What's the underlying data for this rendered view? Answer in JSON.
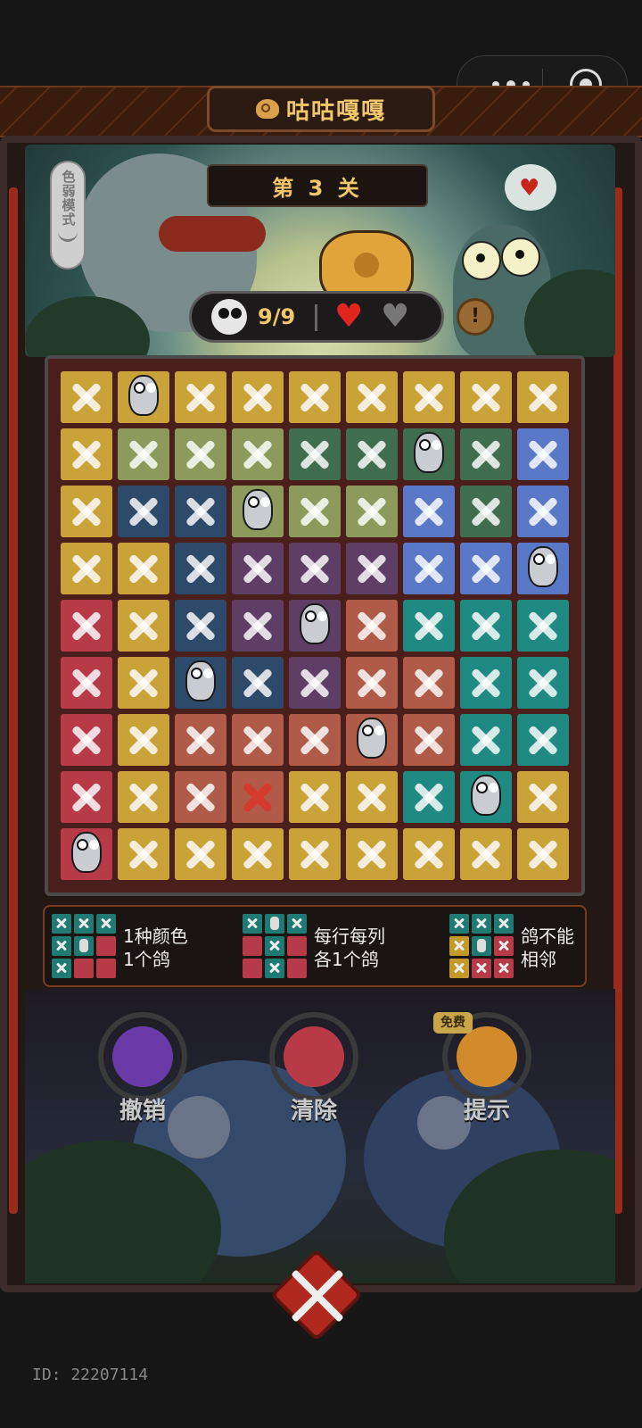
{
  "game": {
    "title": "咕咕嘎嘎",
    "level_label": "第 3 关",
    "colorblind_mode_label": "色弱模式",
    "pigeons_found": "9/9",
    "hearts_remaining": 1,
    "hearts_total": 2,
    "info_icon": "exclamation-icon"
  },
  "board": {
    "rows": 9,
    "cols": 9,
    "colors": {
      "Y": "#c9a23a",
      "O": "#8c9a5c",
      "G": "#3e6e4e",
      "N": "#2e4a6a",
      "B": "#5a78c8",
      "P": "#5e3e64",
      "R": "#b63a48",
      "S": "#b05a48",
      "T": "#1f8a82"
    },
    "regions": [
      "YYYYYYYYY",
      "YOOOGGGGB",
      "YNNOOOBGB",
      "YYNPPPBBB",
      "RYNPPSTTT",
      "RYNNPSSTT",
      "RYSSSSSTT",
      "RYSSYYTTY",
      "RYYYYYYYY"
    ],
    "pigeons": [
      [
        0,
        1
      ],
      [
        1,
        6
      ],
      [
        2,
        3
      ],
      [
        3,
        8
      ],
      [
        4,
        4
      ],
      [
        5,
        2
      ],
      [
        6,
        5
      ],
      [
        7,
        7
      ],
      [
        8,
        0
      ]
    ],
    "red_marks": [
      [
        7,
        3
      ]
    ]
  },
  "rules": [
    {
      "text": "1种颜色\n1个鸽",
      "line1": "1种颜色",
      "line2": "1个鸽"
    },
    {
      "text": "每行每列\n各1个鸽",
      "line1": "每行每列",
      "line2": "各1个鸽"
    },
    {
      "text": "鸽不能\n相邻",
      "line1": "鸽不能",
      "line2": "相邻"
    }
  ],
  "actions": {
    "undo_label": "撤销",
    "clear_label": "清除",
    "hint_label": "提示",
    "hint_badge": "免费"
  },
  "footer": {
    "id_text": "ID: 22207114"
  }
}
